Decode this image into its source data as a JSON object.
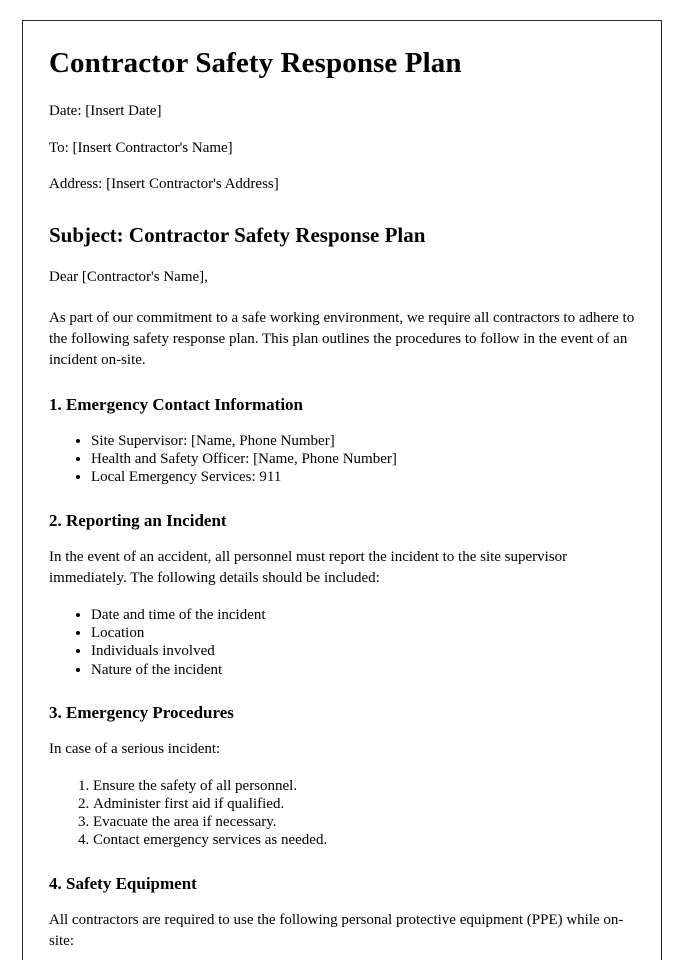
{
  "document": {
    "title": "Contractor Safety Response Plan",
    "meta": [
      "Date: [Insert Date]",
      "To: [Insert Contractor's Name]",
      "Address: [Insert Contractor's Address]"
    ],
    "subject_heading": "Subject: Contractor Safety Response Plan",
    "salutation": "Dear [Contractor's Name],",
    "intro_paragraph": "As part of our commitment to a safe working environment, we require all contractors to adhere to the following safety response plan. This plan outlines the procedures to follow in the event of an incident on-site.",
    "sections": [
      {
        "heading": "1. Emergency Contact Information",
        "items": [
          "Site Supervisor: [Name, Phone Number]",
          "Health and Safety Officer: [Name, Phone Number]",
          "Local Emergency Services: 911"
        ]
      },
      {
        "heading": "2. Reporting an Incident",
        "paragraph": "In the event of an accident, all personnel must report the incident to the site supervisor immediately. The following details should be included:",
        "items": [
          "Date and time of the incident",
          "Location",
          "Individuals involved",
          "Nature of the incident"
        ]
      },
      {
        "heading": "3. Emergency Procedures",
        "paragraph": "In case of a serious incident:",
        "items": [
          "Ensure the safety of all personnel.",
          "Administer first aid if qualified.",
          "Evacuate the area if necessary.",
          "Contact emergency services as needed."
        ]
      },
      {
        "heading": "4. Safety Equipment",
        "paragraph": "All contractors are required to use the following personal protective equipment (PPE) while on-site:"
      }
    ]
  }
}
